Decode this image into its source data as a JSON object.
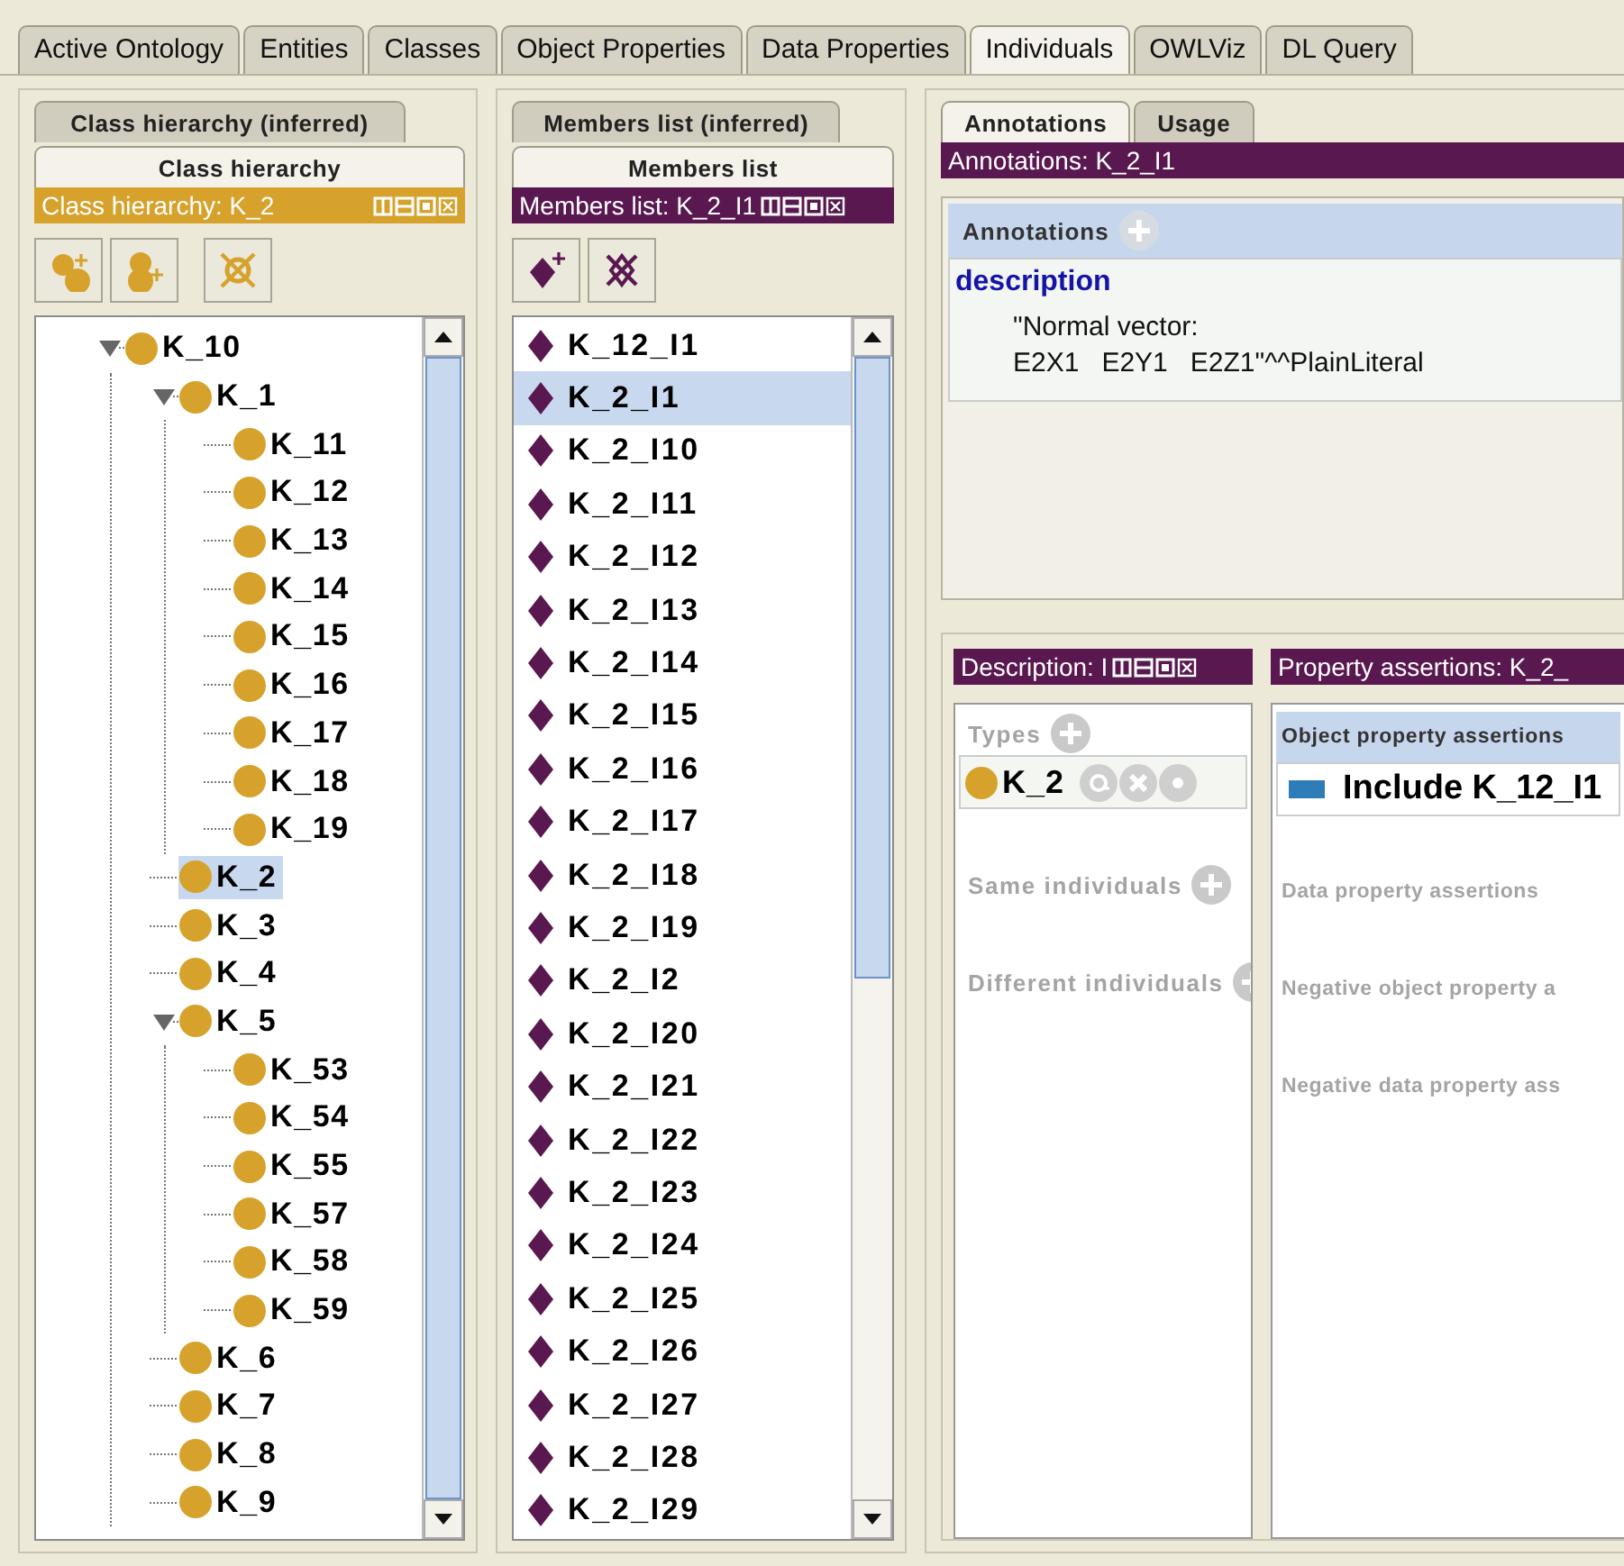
{
  "main_tabs": [
    {
      "label": "Active Ontology",
      "selected": false
    },
    {
      "label": "Entities",
      "selected": false
    },
    {
      "label": "Classes",
      "selected": false
    },
    {
      "label": "Object Properties",
      "selected": false
    },
    {
      "label": "Data Properties",
      "selected": false
    },
    {
      "label": "Individuals",
      "selected": true
    },
    {
      "label": "OWLViz",
      "selected": false
    },
    {
      "label": "DL Query",
      "selected": false
    }
  ],
  "class_view": {
    "tabs": [
      {
        "label": "Class hierarchy (inferred)",
        "selected": false
      },
      {
        "label": "Class hierarchy",
        "selected": true
      }
    ],
    "title": "Class hierarchy: K_2",
    "tree": [
      {
        "label": "K_10",
        "expanded": true,
        "selected": false,
        "children": [
          {
            "label": "K_1",
            "expanded": true,
            "selected": false,
            "children": [
              {
                "label": "K_11",
                "expanded": false,
                "selected": false
              },
              {
                "label": "K_12",
                "expanded": false,
                "selected": false
              },
              {
                "label": "K_13",
                "expanded": false,
                "selected": false
              },
              {
                "label": "K_14",
                "expanded": false,
                "selected": false
              },
              {
                "label": "K_15",
                "expanded": false,
                "selected": false
              },
              {
                "label": "K_16",
                "expanded": false,
                "selected": false
              },
              {
                "label": "K_17",
                "expanded": false,
                "selected": false
              },
              {
                "label": "K_18",
                "expanded": false,
                "selected": false
              },
              {
                "label": "K_19",
                "expanded": false,
                "selected": false
              }
            ]
          },
          {
            "label": "K_2",
            "expanded": false,
            "selected": true
          },
          {
            "label": "K_3",
            "expanded": false,
            "selected": false
          },
          {
            "label": "K_4",
            "expanded": false,
            "selected": false
          },
          {
            "label": "K_5",
            "expanded": true,
            "selected": false,
            "children": [
              {
                "label": "K_53",
                "expanded": false,
                "selected": false
              },
              {
                "label": "K_54",
                "expanded": false,
                "selected": false
              },
              {
                "label": "K_55",
                "expanded": false,
                "selected": false
              },
              {
                "label": "K_57",
                "expanded": false,
                "selected": false
              },
              {
                "label": "K_58",
                "expanded": false,
                "selected": false
              },
              {
                "label": "K_59",
                "expanded": false,
                "selected": false
              }
            ]
          },
          {
            "label": "K_6",
            "expanded": false,
            "selected": false
          },
          {
            "label": "K_7",
            "expanded": false,
            "selected": false
          },
          {
            "label": "K_8",
            "expanded": false,
            "selected": false
          },
          {
            "label": "K_9",
            "expanded": false,
            "selected": false
          }
        ]
      }
    ]
  },
  "members_view": {
    "tabs": [
      {
        "label": "Members list (inferred)",
        "selected": false
      },
      {
        "label": "Members list",
        "selected": true
      }
    ],
    "title": "Members list: K_2_I1",
    "items": [
      {
        "label": "K_12_I1",
        "selected": false
      },
      {
        "label": "K_2_I1",
        "selected": true
      },
      {
        "label": "K_2_I10",
        "selected": false
      },
      {
        "label": "K_2_I11",
        "selected": false
      },
      {
        "label": "K_2_I12",
        "selected": false
      },
      {
        "label": "K_2_I13",
        "selected": false
      },
      {
        "label": "K_2_I14",
        "selected": false
      },
      {
        "label": "K_2_I15",
        "selected": false
      },
      {
        "label": "K_2_I16",
        "selected": false
      },
      {
        "label": "K_2_I17",
        "selected": false
      },
      {
        "label": "K_2_I18",
        "selected": false
      },
      {
        "label": "K_2_I19",
        "selected": false
      },
      {
        "label": "K_2_I2",
        "selected": false
      },
      {
        "label": "K_2_I20",
        "selected": false
      },
      {
        "label": "K_2_I21",
        "selected": false
      },
      {
        "label": "K_2_I22",
        "selected": false
      },
      {
        "label": "K_2_I23",
        "selected": false
      },
      {
        "label": "K_2_I24",
        "selected": false
      },
      {
        "label": "K_2_I25",
        "selected": false
      },
      {
        "label": "K_2_I26",
        "selected": false
      },
      {
        "label": "K_2_I27",
        "selected": false
      },
      {
        "label": "K_2_I28",
        "selected": false
      },
      {
        "label": "K_2_I29",
        "selected": false
      }
    ]
  },
  "annotations_view": {
    "tabs": [
      {
        "label": "Annotations",
        "selected": true
      },
      {
        "label": "Usage",
        "selected": false
      }
    ],
    "title": "Annotations: K_2_I1",
    "section": "Annotations",
    "property": "description",
    "value_lines": [
      "\"Normal vector:",
      "E2X1   E2Y1   E2Z1\"^^PlainLiteral"
    ]
  },
  "description_view": {
    "title": "Description: I",
    "sections": [
      {
        "label": "Types",
        "has_add": true,
        "items": [
          "K_2"
        ]
      },
      {
        "label": "Same individuals",
        "has_add": true
      },
      {
        "label": "Different individuals",
        "has_add": true
      }
    ]
  },
  "property_view": {
    "title": "Property assertions: K_2_",
    "sections": [
      {
        "label": "Object property assertions",
        "highlighted": true,
        "items": [
          "Include K_12_I1"
        ]
      },
      {
        "label": "Data property assertions",
        "highlighted": false
      },
      {
        "label": "Negative object property a",
        "highlighted": false
      },
      {
        "label": "Negative data property ass",
        "highlighted": false
      }
    ]
  }
}
